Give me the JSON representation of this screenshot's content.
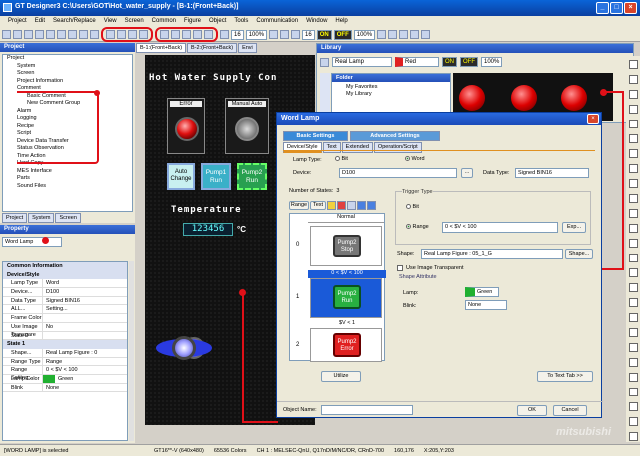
{
  "app": {
    "title": "GT Designer3 C:\\Users\\GOT\\Hot_water_supply - [B-1:(Front+Back)]"
  },
  "menu": [
    "Project",
    "Edit",
    "Search/Replace",
    "View",
    "Screen",
    "Common",
    "Figure",
    "Object",
    "Tools",
    "Communication",
    "Window",
    "Help"
  ],
  "toolbar": {
    "zoom": "100%",
    "grid": "16",
    "zoom2": "100%",
    "grid2": "16",
    "on_label": "ON",
    "off_label": "OFF"
  },
  "project_panel": {
    "title": "Project",
    "items": [
      "Project",
      "System",
      "Screen",
      "Project Information",
      "Comment",
      "Basic Comment",
      "New Comment Group",
      "Alarm",
      "Logging",
      "Recipe",
      "Script",
      "Device Data Transfer",
      "Status Observation",
      "Time Action",
      "Hard Copy",
      "MES Interface",
      "Parts",
      "Sound Files"
    ],
    "tabs": [
      "Project",
      "System",
      "Screen"
    ]
  },
  "property_panel": {
    "title": "Property",
    "object": "Word Lamp",
    "sections": [
      {
        "name": "Common Information"
      },
      {
        "name": "Device/Style"
      }
    ],
    "rows": [
      {
        "k": "Lamp Type",
        "v": "Word"
      },
      {
        "k": "Device...",
        "v": "D100"
      },
      {
        "k": "Data Type",
        "v": "Signed BIN16"
      },
      {
        "k": "ALL...",
        "v": "Setting..."
      },
      {
        "k": "Frame Color",
        "v": ""
      },
      {
        "k": "Use Image Transpare",
        "v": "No"
      },
      {
        "k": "State 0",
        "v": ""
      }
    ],
    "state1_title": "State 1",
    "state1_rows": [
      {
        "k": "Shape...",
        "v": "Real Lamp Figure : 0"
      },
      {
        "k": "Range Type",
        "v": "Range"
      },
      {
        "k": "Range Setting...",
        "v": "0 < $V < 100"
      },
      {
        "k": "Lamp Color",
        "v": "Green"
      },
      {
        "k": "Blink",
        "v": "None"
      }
    ]
  },
  "screen_tabs": [
    "B-1:(Front+Back)",
    "B-2:(Front+Back)",
    "Envi"
  ],
  "canvas": {
    "title": "Hot Water Supply Con",
    "error_label": "Error",
    "manual_label": "Manual Auto",
    "sw1": "Auto Change",
    "sw2": "Pump1 Run",
    "sw3": "Pump2 Run",
    "temp_label": "Temperature",
    "temp_value": "123456",
    "unit": "°C"
  },
  "library": {
    "title": "Library",
    "select": "Real Lamp",
    "color": "Red",
    "zoom": "100%",
    "folder_title": "Folder",
    "folders": [
      "My Favorites",
      "My Library"
    ]
  },
  "dialog": {
    "title": "Word Lamp",
    "top_tabs": [
      "Basic Settings",
      "Advanced Settings"
    ],
    "sub_tabs": [
      "Device/Style",
      "Text",
      "Extended",
      "Operation/Script"
    ],
    "lamp_type_label": "Lamp Type:",
    "opt_bit": "Bit",
    "opt_word": "Word",
    "device_label": "Device:",
    "device_value": "D100",
    "data_type_label": "Data Type:",
    "data_type_value": "Signed BIN16",
    "num_states_label": "Number of States:",
    "num_states": "3",
    "range_btn": "Range",
    "text_btn": "Text",
    "trigger_label": "Trigger Type",
    "trig_bit": "Bit",
    "trig_range": "Range",
    "range_value": "0 < $V < 100",
    "exp_btn": "Exp...",
    "shape_label": "Shape:",
    "shape_value": "Real Lamp Figure : 05_1_G",
    "shape_btn": "Shape...",
    "use_image": "Use Image Transparent",
    "shape_attr": "Shape Attribute",
    "lamp_label": "Lamp:",
    "lamp_value": "Green",
    "blink_label": "Blink:",
    "blink_value": "None",
    "col_normal": "Normal",
    "states": [
      {
        "idx": "0",
        "cond": "",
        "label": "Pump2 Stop"
      },
      {
        "idx": "1",
        "cond": "0 < $V < 100",
        "label": "Pump2 Run"
      },
      {
        "idx": "2",
        "cond": "$V < 1",
        "label": "Pump2 Error"
      }
    ],
    "utilize_btn": "Utilize",
    "to_text_btn": "To Text Tab >>",
    "object_name_label": "Object Name:",
    "ok_btn": "OK",
    "cancel_btn": "Cancel"
  },
  "status": {
    "left": "[WORD LAMP] is selected",
    "gt": "GT16**-V (640x480)",
    "colors": "65536 Colors",
    "ch": "CH 1 : MELSEC-QnU, Q17nD/M/NC/DR, CRnD-700",
    "size": "160,176",
    "pos": "X:205,Y:203"
  },
  "watermark": "mitsubishi"
}
